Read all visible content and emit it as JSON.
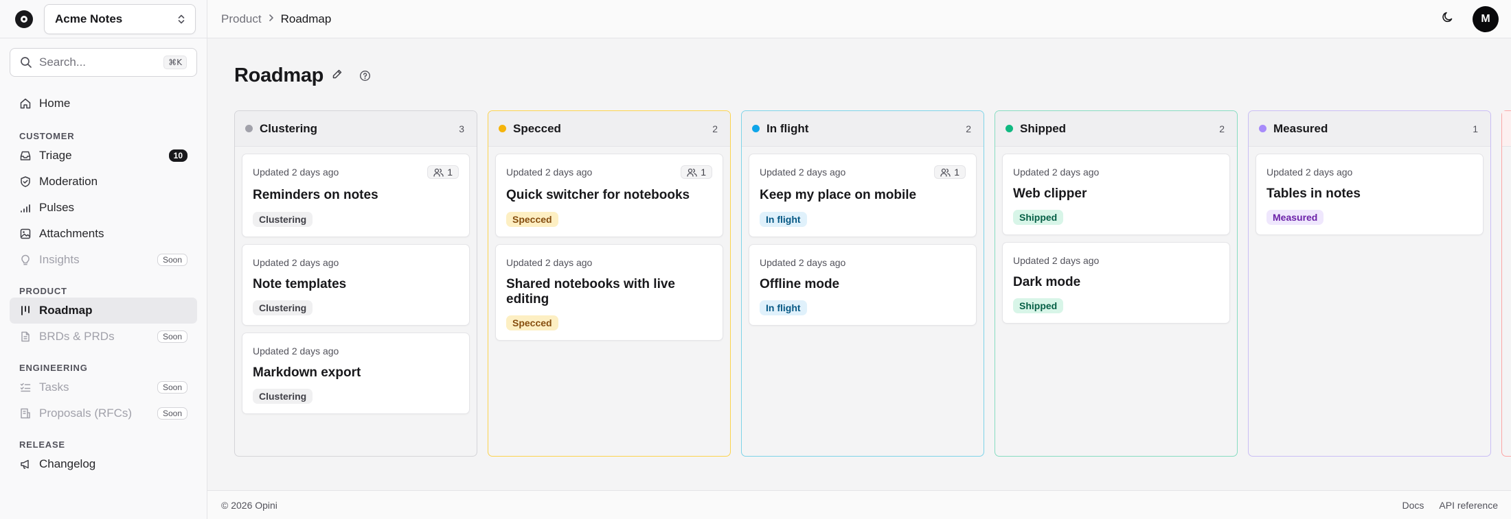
{
  "workspace": {
    "name": "Acme Notes"
  },
  "search": {
    "placeholder": "Search...",
    "shortcut": "⌘K"
  },
  "nav": {
    "home": "Home",
    "sections": [
      {
        "label": "CUSTOMER",
        "items": [
          {
            "label": "Triage",
            "badge": "10"
          },
          {
            "label": "Moderation"
          },
          {
            "label": "Pulses"
          },
          {
            "label": "Attachments"
          },
          {
            "label": "Insights",
            "soon": "Soon"
          }
        ]
      },
      {
        "label": "PRODUCT",
        "items": [
          {
            "label": "Roadmap"
          },
          {
            "label": "BRDs & PRDs",
            "soon": "Soon"
          }
        ]
      },
      {
        "label": "ENGINEERING",
        "items": [
          {
            "label": "Tasks",
            "soon": "Soon"
          },
          {
            "label": "Proposals (RFCs)",
            "soon": "Soon"
          }
        ]
      },
      {
        "label": "RELEASE",
        "items": [
          {
            "label": "Changelog"
          }
        ]
      }
    ]
  },
  "breadcrumb": {
    "parent": "Product",
    "current": "Roadmap"
  },
  "user": {
    "initial": "M"
  },
  "page": {
    "title": "Roadmap"
  },
  "columns": [
    {
      "title": "Clustering",
      "count": "3",
      "color": "#a1a1aa",
      "border": "#d4d4d8",
      "tag_bg": "#f0f0f1",
      "tag_fg": "#3f3f46",
      "cards": [
        {
          "updated": "Updated 2 days ago",
          "voters": "1",
          "title": "Reminders on notes",
          "tag": "Clustering"
        },
        {
          "updated": "Updated 2 days ago",
          "title": "Note templates",
          "tag": "Clustering"
        },
        {
          "updated": "Updated 2 days ago",
          "title": "Markdown export",
          "tag": "Clustering"
        }
      ]
    },
    {
      "title": "Specced",
      "count": "2",
      "color": "#f5b40b",
      "border": "#fcd34d",
      "tag_bg": "#fdefc3",
      "tag_fg": "#854d0e",
      "cards": [
        {
          "updated": "Updated 2 days ago",
          "voters": "1",
          "title": "Quick switcher for notebooks",
          "tag": "Specced"
        },
        {
          "updated": "Updated 2 days ago",
          "title": "Shared notebooks with live editing",
          "tag": "Specced"
        }
      ]
    },
    {
      "title": "In flight",
      "count": "2",
      "color": "#0ea5e9",
      "border": "#7dd3e8",
      "tag_bg": "#e0f1fb",
      "tag_fg": "#075985",
      "cards": [
        {
          "updated": "Updated 2 days ago",
          "voters": "1",
          "title": "Keep my place on mobile",
          "tag": "In flight"
        },
        {
          "updated": "Updated 2 days ago",
          "title": "Offline mode",
          "tag": "In flight"
        }
      ]
    },
    {
      "title": "Shipped",
      "count": "2",
      "color": "#10b981",
      "border": "#86dcc1",
      "tag_bg": "#d8f5e8",
      "tag_fg": "#065f46",
      "cards": [
        {
          "updated": "Updated 2 days ago",
          "title": "Web clipper",
          "tag": "Shipped"
        },
        {
          "updated": "Updated 2 days ago",
          "title": "Dark mode",
          "tag": "Shipped"
        }
      ]
    },
    {
      "title": "Measured",
      "count": "1",
      "color": "#a78bfa",
      "border": "#c9bdf5",
      "tag_bg": "#efe7fd",
      "tag_fg": "#6b21a8",
      "cards": [
        {
          "updated": "Updated 2 days ago",
          "title": "Tables in notes",
          "tag": "Measured"
        }
      ]
    }
  ],
  "footer": {
    "copyright": "© 2026 Opini",
    "docs": "Docs",
    "api": "API reference"
  }
}
